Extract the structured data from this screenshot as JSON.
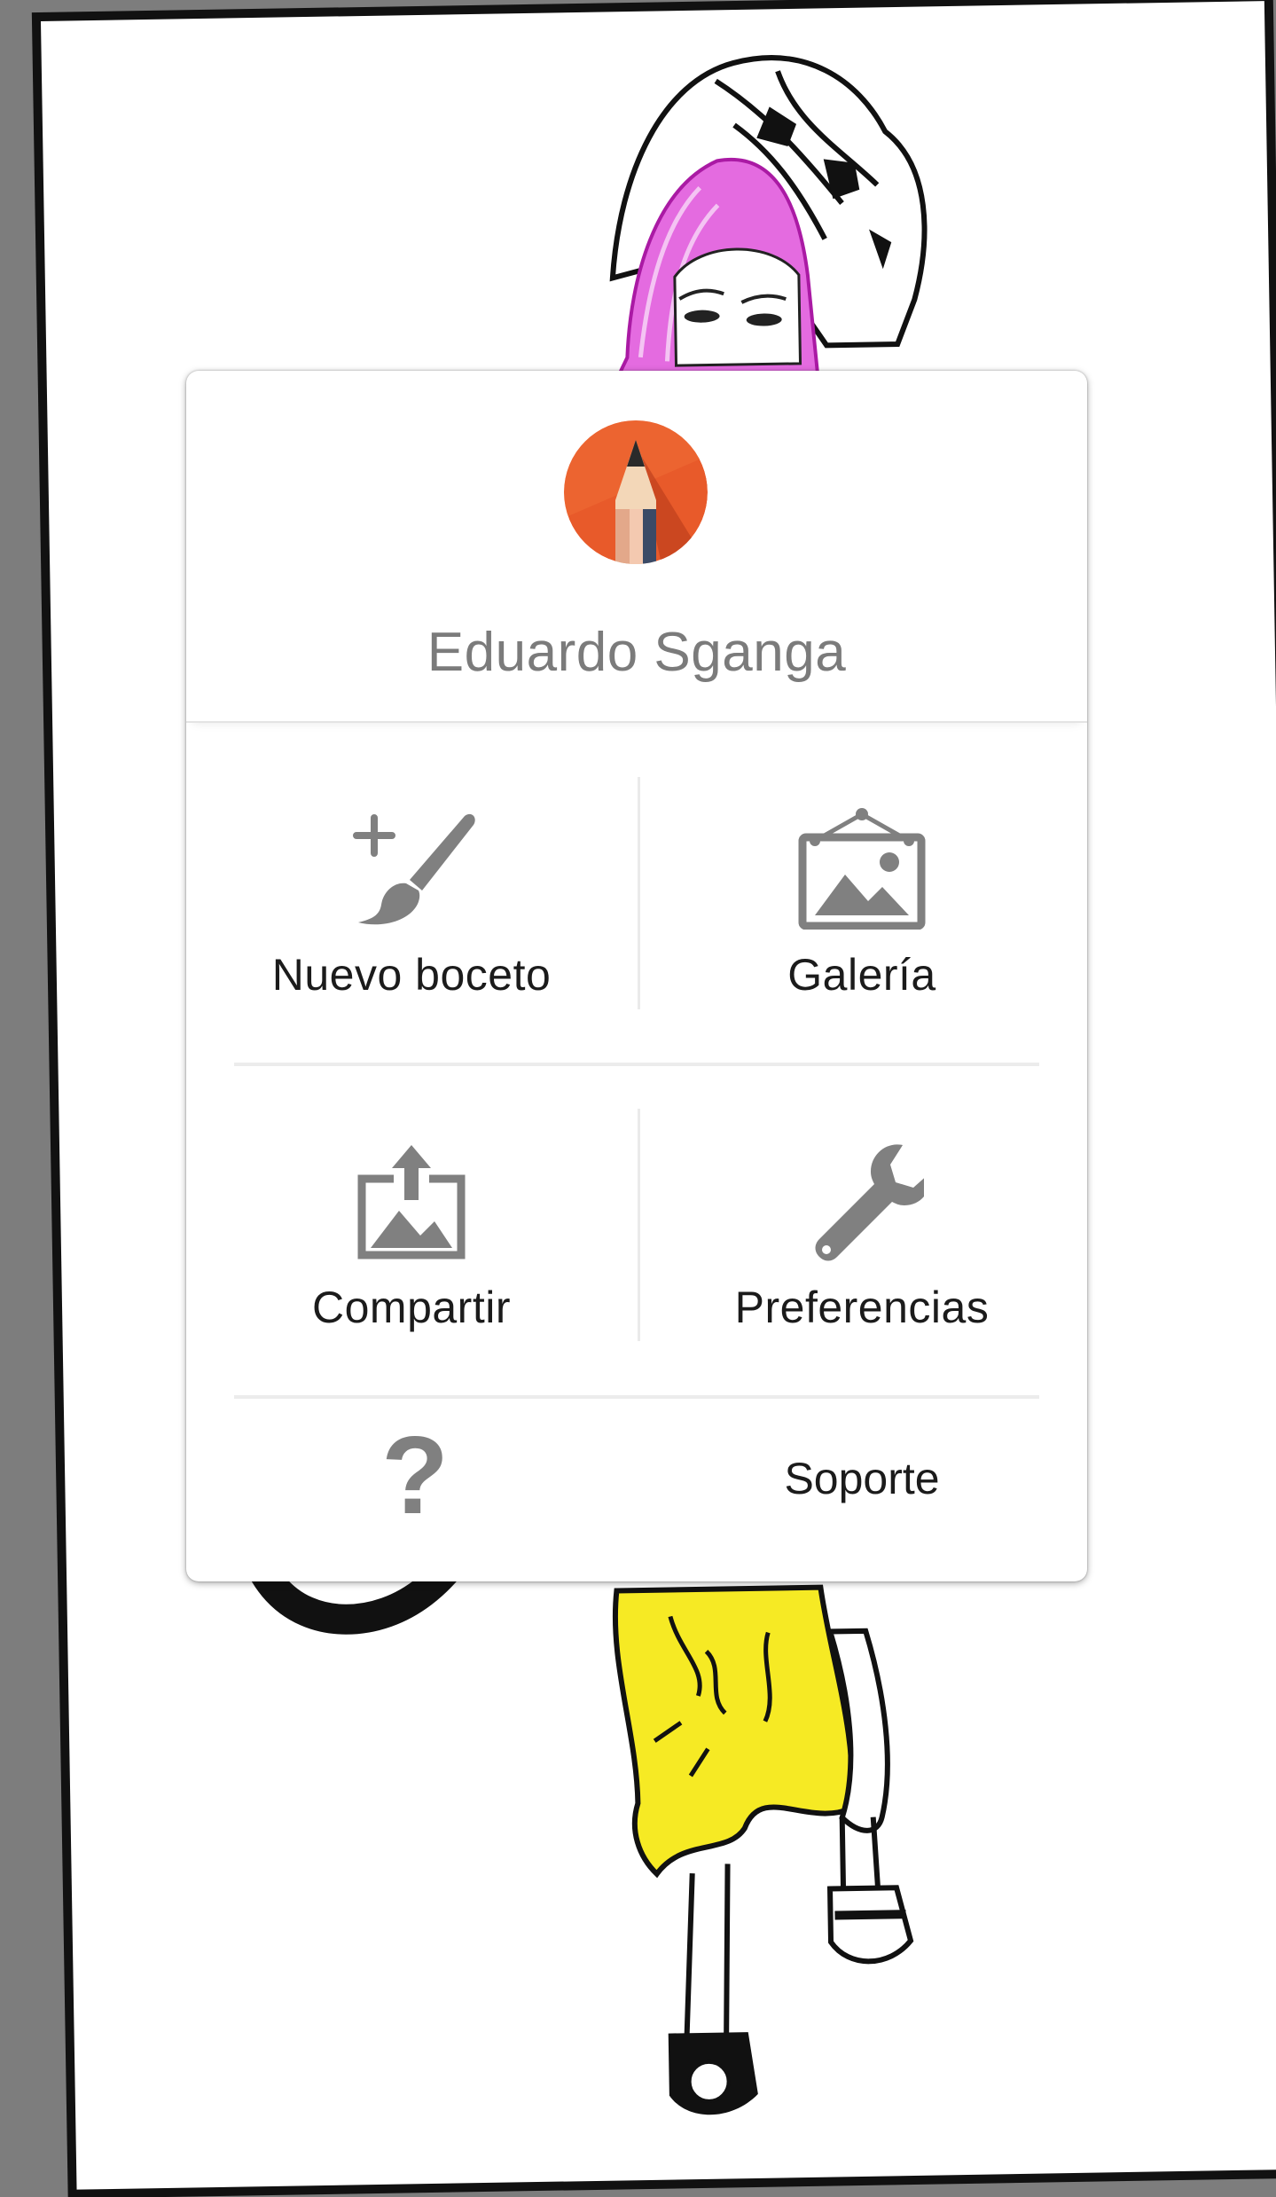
{
  "profile": {
    "user_name": "Eduardo Sganga",
    "avatar_icon": "pencil-app-logo-icon"
  },
  "menu": {
    "tiles": [
      {
        "label": "Nuevo boceto",
        "icon": "new-sketch-brush-icon"
      },
      {
        "label": "Galería",
        "icon": "gallery-picture-icon"
      },
      {
        "label": "Compartir",
        "icon": "share-upload-icon"
      },
      {
        "label": "Preferencias",
        "icon": "wrench-icon"
      }
    ],
    "support": {
      "label": "Soporte",
      "glyph": "?",
      "icon": "question-mark-icon"
    }
  },
  "colors": {
    "icon_gray": "#808080",
    "avatar_orange": "#e8582b",
    "hair_magenta": "#d94ad9",
    "dress_yellow": "#f4e81c"
  }
}
